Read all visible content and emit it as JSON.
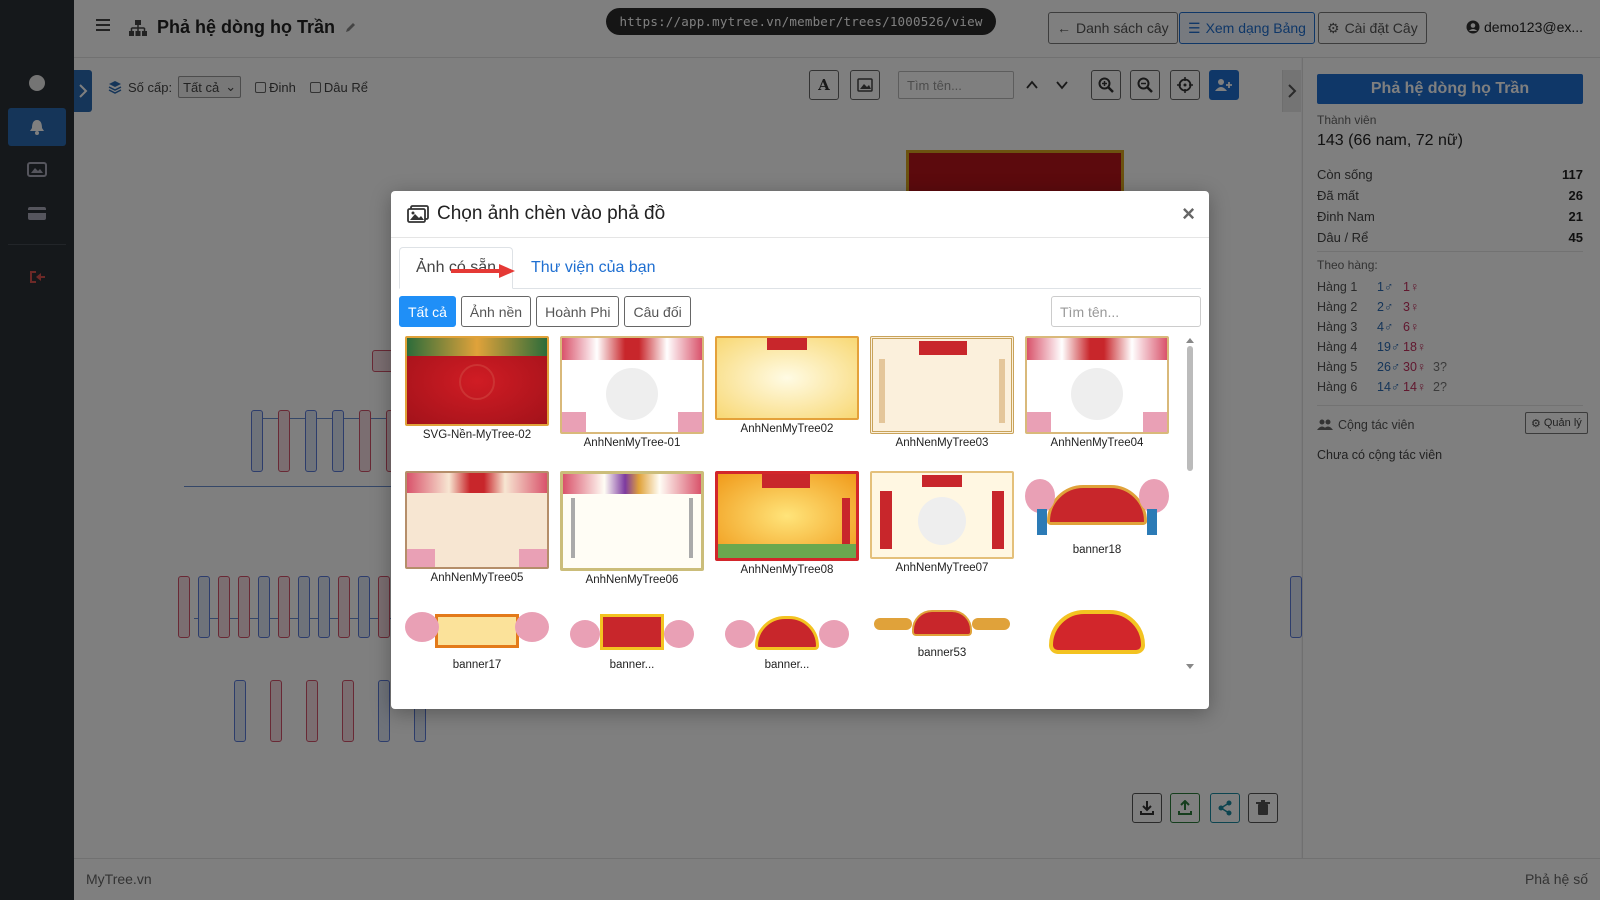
{
  "header": {
    "tree_title": "Phả hệ dòng họ Trần",
    "url": "https://app.mytree.vn/member/trees/1000526/view",
    "btn_list": "Danh sách cây",
    "btn_table": "Xem dạng Bảng",
    "btn_settings": "Cài đặt Cây",
    "user": "demo123@ex..."
  },
  "toolbar": {
    "level_label": "Số cấp:",
    "level_value": "Tất cả",
    "chk_dinh": "Đinh",
    "chk_dau_re": "Dâu Rể",
    "search_placeholder": "Tìm tên..."
  },
  "panel": {
    "title": "Phả hệ dòng họ Trần",
    "members_label": "Thành viên",
    "members_value": "143 (66 nam, 72 nữ)",
    "stats": [
      {
        "label": "Còn sống",
        "value": "117"
      },
      {
        "label": "Đã mất",
        "value": "26"
      },
      {
        "label": "Đinh Nam",
        "value": "21"
      },
      {
        "label": "Dâu / Rể",
        "value": "45"
      }
    ],
    "by_rank_label": "Theo hàng:",
    "ranks": [
      {
        "label": "Hàng 1",
        "m": "1♂",
        "f": "1♀",
        "u": ""
      },
      {
        "label": "Hàng 2",
        "m": "2♂",
        "f": "3♀",
        "u": ""
      },
      {
        "label": "Hàng 3",
        "m": "4♂",
        "f": "6♀",
        "u": ""
      },
      {
        "label": "Hàng 4",
        "m": "19♂",
        "f": "18♀",
        "u": ""
      },
      {
        "label": "Hàng 5",
        "m": "26♂",
        "f": "30♀",
        "u": "3?"
      },
      {
        "label": "Hàng 6",
        "m": "14♂",
        "f": "14♀",
        "u": "2?"
      }
    ],
    "collab_label": "Cộng tác viên",
    "collab_manage": "Quản lý",
    "collab_empty": "Chưa có cộng tác viên"
  },
  "footer": {
    "left": "MyTree.vn",
    "right": "Phả hệ số"
  },
  "modal": {
    "title": "Chọn ảnh chèn vào phả đồ",
    "close": "×",
    "tab_active": "Ảnh có sẵn",
    "tab_library": "Thư viện của bạn",
    "filters": [
      "Tất cả",
      "Ảnh nền",
      "Hoành Phi",
      "Câu đối"
    ],
    "search_placeholder": "Tìm tên...",
    "images": [
      {
        "name": "SVG-Nền-MyTree-02",
        "style": "red"
      },
      {
        "name": "AnhNenMyTree-01",
        "style": "white-frame"
      },
      {
        "name": "AnhNenMyTree02",
        "style": "yellow"
      },
      {
        "name": "AnhNenMyTree03",
        "style": "beige"
      },
      {
        "name": "AnhNenMyTree04",
        "style": "white-frame"
      },
      {
        "name": "AnhNenMyTree05",
        "style": "peach"
      },
      {
        "name": "AnhNenMyTree06",
        "style": "cream"
      },
      {
        "name": "AnhNenMyTree08",
        "style": "orange"
      },
      {
        "name": "AnhNenMyTree07",
        "style": "cream-pillars"
      },
      {
        "name": "banner18",
        "style": "banner"
      },
      {
        "name": "banner17",
        "style": "banner"
      },
      {
        "name": "banner...",
        "style": "banner"
      },
      {
        "name": "banner...",
        "style": "banner"
      },
      {
        "name": "banner53",
        "style": "banner-flat"
      },
      {
        "name": "",
        "style": "banner-red"
      }
    ]
  },
  "colors": {
    "primary": "#1f6fd1",
    "sidebar": "#2b3036",
    "male": "#2a6bb3",
    "female": "#c2305f"
  }
}
